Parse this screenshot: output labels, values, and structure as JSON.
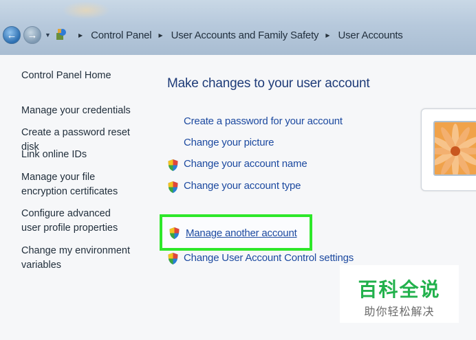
{
  "window": {
    "breadcrumbs": [
      "Control Panel",
      "User Accounts and Family Safety",
      "User Accounts"
    ]
  },
  "sidebar": {
    "items": [
      {
        "label": "Control Panel Home"
      },
      {
        "label": "Manage your credentials"
      },
      {
        "label": "Create a password reset disk"
      },
      {
        "label": "Link online IDs"
      },
      {
        "label": "Manage your file encryption certificates"
      },
      {
        "label": "Configure advanced user profile properties"
      },
      {
        "label": "Change my environment variables"
      }
    ]
  },
  "main": {
    "title": "Make changes to your user account",
    "tasks": [
      {
        "label": "Create a password for your account",
        "icon": "none"
      },
      {
        "label": "Change your picture",
        "icon": "none"
      },
      {
        "label": "Change your account name",
        "icon": "shield-icon"
      },
      {
        "label": "Change your account type",
        "icon": "shield-icon"
      },
      {
        "label": "Manage another account",
        "icon": "shield-icon",
        "highlighted": true
      },
      {
        "label": "Change User Account Control settings",
        "icon": "shield-icon"
      }
    ]
  },
  "colors": {
    "link": "#1d4aa0",
    "title": "#1e3b78",
    "highlight": "#2ee82a",
    "watermark": "#22b14c"
  },
  "watermark": {
    "text": "百科全说",
    "subtext": "助你轻松解决"
  }
}
